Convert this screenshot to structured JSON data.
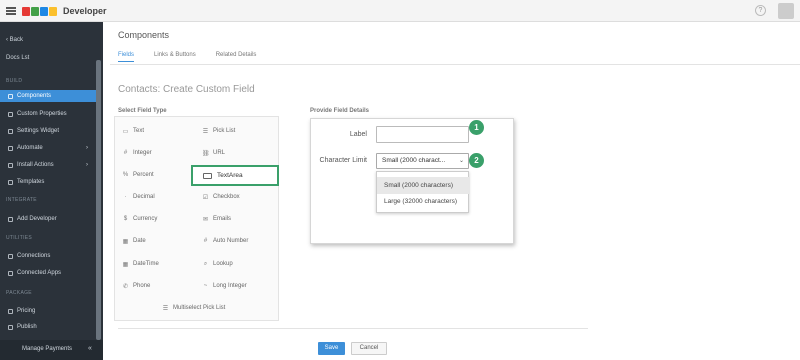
{
  "app": {
    "brand": "Developer",
    "logo_colors": [
      "#e53935",
      "#43a047",
      "#1e88e5",
      "#fbc02d"
    ]
  },
  "sidebar": {
    "back": "Back",
    "org": "Docs Lst",
    "sections": [
      "BUILD",
      "INTEGRATE",
      "UTILITIES",
      "PACKAGE"
    ],
    "items": [
      {
        "label": "Components",
        "active": true
      },
      {
        "label": "Custom Properties"
      },
      {
        "label": "Settings Widget"
      },
      {
        "label": "Automate"
      },
      {
        "label": "Install Actions"
      },
      {
        "label": "Templates"
      },
      {
        "label": "Add Developer"
      },
      {
        "label": "Connections"
      },
      {
        "label": "Connected Apps"
      },
      {
        "label": "Pricing"
      },
      {
        "label": "Publish"
      }
    ],
    "footer": "Manage Payments",
    "accent": "#3d8fd8"
  },
  "main": {
    "page_title": "Components",
    "tabs": [
      "Fields",
      "Links & Buttons",
      "Related Details"
    ],
    "form_title": "Contacts: Create Custom Field",
    "field_types_heading": "Select Field Type",
    "field_types": [
      {
        "icon": "▭",
        "label": "Text"
      },
      {
        "icon": "☰",
        "label": "Pick List"
      },
      {
        "icon": "#",
        "label": "Integer"
      },
      {
        "icon": "⛓",
        "label": "URL"
      },
      {
        "icon": "%",
        "label": "Percent"
      },
      {
        "icon": "▭",
        "label": "TextArea"
      },
      {
        "icon": "·",
        "label": "Decimal"
      },
      {
        "icon": "☑",
        "label": "Checkbox"
      },
      {
        "icon": "$",
        "label": "Currency"
      },
      {
        "icon": "✉",
        "label": "Emails"
      },
      {
        "icon": "▦",
        "label": "Date"
      },
      {
        "icon": "#",
        "label": "Auto Number"
      },
      {
        "icon": "▦",
        "label": "DateTime"
      },
      {
        "icon": "⌕",
        "label": "Lookup"
      },
      {
        "icon": "✆",
        "label": "Phone"
      },
      {
        "icon": "~",
        "label": "Long Integer"
      },
      {
        "icon": "☰",
        "label": "Multiselect Pick List"
      }
    ],
    "field_details_heading": "Provide Field Details",
    "label_field": {
      "label": "Label",
      "value": ""
    },
    "char_limit": {
      "label": "Character Limit",
      "selected": "Small (2000 charact...",
      "options": [
        "Small (2000 characters)",
        "Large (32000 characters)"
      ]
    },
    "badges": [
      "1",
      "2"
    ],
    "badge_color": "#3aa06a",
    "buttons": {
      "save": "Save",
      "cancel": "Cancel"
    }
  }
}
